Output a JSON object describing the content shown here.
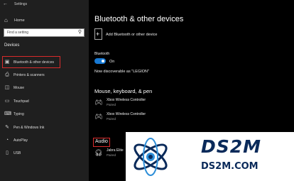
{
  "app": {
    "title": "Settings",
    "home": "Home"
  },
  "search": {
    "placeholder": "Find a setting"
  },
  "sidebar": {
    "section_label": "Devices",
    "items": [
      {
        "label": "Bluetooth & other devices",
        "icon": "bluetooth-devices-icon",
        "active": true
      },
      {
        "label": "Printers & scanners",
        "icon": "printer-icon"
      },
      {
        "label": "Mouse",
        "icon": "mouse-icon"
      },
      {
        "label": "Touchpad",
        "icon": "touchpad-icon"
      },
      {
        "label": "Typing",
        "icon": "keyboard-icon"
      },
      {
        "label": "Pen & Windows Ink",
        "icon": "pen-icon"
      },
      {
        "label": "AutoPlay",
        "icon": "autoplay-icon"
      },
      {
        "label": "USB",
        "icon": "usb-icon"
      }
    ]
  },
  "main": {
    "title": "Bluetooth & other devices",
    "add_device": "Add Bluetooth or other device",
    "bluetooth_label": "Bluetooth",
    "bluetooth_state": "On",
    "discoverable": "Now discoverable as \"LEGION\"",
    "section_mouse": "Mouse, keyboard, & pen",
    "devices": [
      {
        "name": "Xbox Wireless Controller",
        "status": "Paired"
      },
      {
        "name": "Xbox Wireless Controller",
        "status": "Paired"
      }
    ],
    "section_audio": "Audio",
    "audio_devices": [
      {
        "name": "Jabra Elite",
        "status": "Paired"
      }
    ]
  },
  "watermark": {
    "name": "DS2M",
    "url": "DS2M.COM"
  },
  "colors": {
    "accent": "#1779d4",
    "highlight": "#d92b2b",
    "sidebar_bg": "#1f1f1f"
  }
}
